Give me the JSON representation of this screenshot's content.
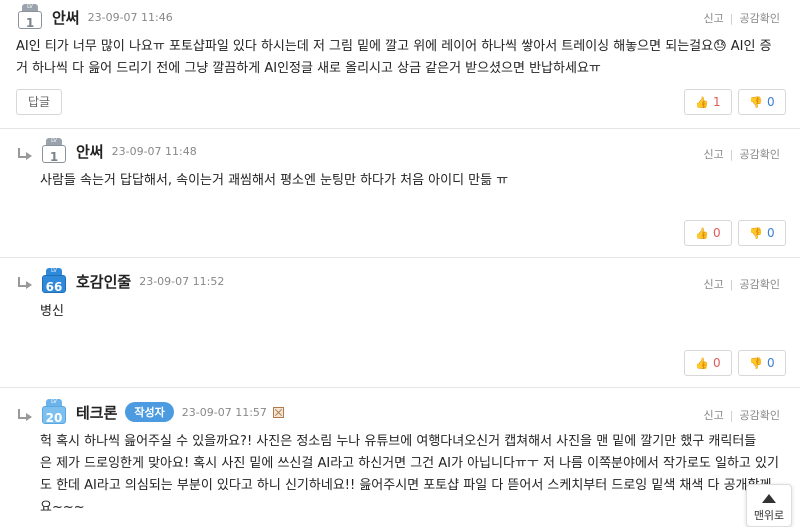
{
  "common": {
    "report_label": "신고",
    "like_check_label": "공감확인",
    "reply_label": "답글"
  },
  "comments": [
    {
      "nick": "안써",
      "date": "23-09-07 11:46",
      "level": "1",
      "text_line1": "AI인 티가 너무 많이 나요ㅠ 포토샵파일 있다 하시는데 저 그림 밑에 깔고 위에 레이어 하나씩 쌓아서 트레이싱 해놓으면 되는걸요😓 AI인 증",
      "text_line2": "거 하나씩 다 읊어 드리기 전에 그냥 깔끔하게 AI인정글 새로 올리시고 상금 같은거 받으셨으면 반납하세요ㅠ",
      "up": "1",
      "down": "0"
    },
    {
      "nick": "안써",
      "date": "23-09-07 11:48",
      "level": "1",
      "text_line1": "사람들 속는거 답답해서, 속이는거 괘씸해서 평소엔 눈팅만 하다가 처음 아이디 만듦 ㅠ",
      "up": "0",
      "down": "0"
    },
    {
      "nick": "호감인줄",
      "date": "23-09-07 11:52",
      "level": "66",
      "text_line1": "병신",
      "up": "0",
      "down": "0"
    },
    {
      "nick": "테크론",
      "author_badge": "작성자",
      "date": "23-09-07 11:57",
      "level": "20",
      "text_line1": "헉 혹시 하나씩 읊어주실 수 있을까요?! 사진은 정소림 누나 유튜브에 여행다녀오신거 캡쳐해서 사진을 맨 밑에 깔기만 했구 캐릭터들",
      "text_line2": "은 제가 드로잉한게 맞아요! 혹시 사진 밑에 쓰신걸 AI라고 하신거면 그건 AI가 아닙니다ㅠㅜ 저 나름 이쪽분야에서 작가로도 일하고 있기",
      "text_line3": "도 한데 AI라고 의심되는 부분이 있다고 하니 신기하네요!! 읊어주시면 포토샵 파일 다 뜯어서 스케치부터 드로잉 밑색 채색 다 공개할께",
      "text_line4": "요~~~"
    }
  ],
  "top_button": {
    "label": "맨위로"
  }
}
